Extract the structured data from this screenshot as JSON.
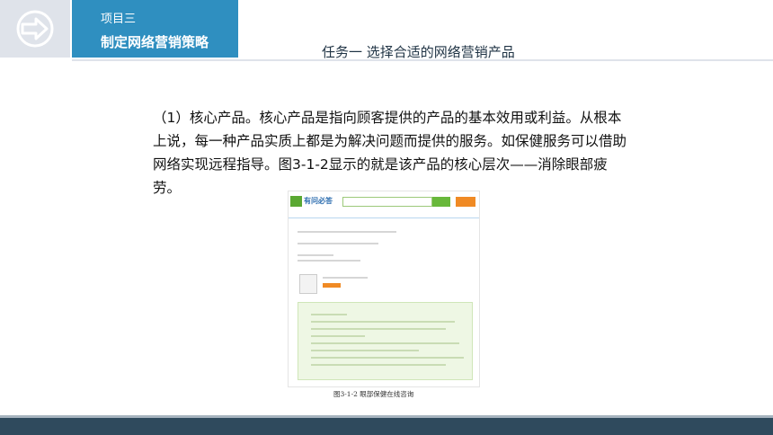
{
  "header": {
    "project_label": "项目三",
    "strategy_title": "制定网络营销策略",
    "task_title": "任务一   选择合适的网络营销产品"
  },
  "content": {
    "paragraph": "（1）核心产品。核心产品是指向顾客提供的产品的基本效用或利益。从根本上说，每一种产品实质上都是为解决问题而提供的服务。如保健服务可以借助网络实现远程指导。图3-1-2显示的就是该产品的核心层次——消除眼部疲劳。"
  },
  "figure": {
    "site_name": "有问必答",
    "caption": "图3-1-2  眼部保健在线咨询"
  },
  "colors": {
    "header_blue": "#2f8fc0",
    "footer_dark": "#2f4a5d",
    "icon_bg": "#dfe3ea"
  }
}
